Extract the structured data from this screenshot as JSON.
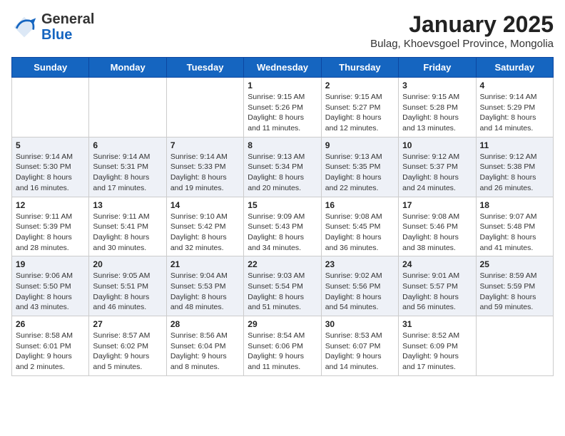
{
  "logo": {
    "general": "General",
    "blue": "Blue"
  },
  "title": "January 2025",
  "subtitle": "Bulag, Khoevsgoel Province, Mongolia",
  "weekdays": [
    "Sunday",
    "Monday",
    "Tuesday",
    "Wednesday",
    "Thursday",
    "Friday",
    "Saturday"
  ],
  "weeks": [
    [
      {
        "day": "",
        "sunrise": "",
        "sunset": "",
        "daylight": ""
      },
      {
        "day": "",
        "sunrise": "",
        "sunset": "",
        "daylight": ""
      },
      {
        "day": "",
        "sunrise": "",
        "sunset": "",
        "daylight": ""
      },
      {
        "day": "1",
        "sunrise": "Sunrise: 9:15 AM",
        "sunset": "Sunset: 5:26 PM",
        "daylight": "Daylight: 8 hours and 11 minutes."
      },
      {
        "day": "2",
        "sunrise": "Sunrise: 9:15 AM",
        "sunset": "Sunset: 5:27 PM",
        "daylight": "Daylight: 8 hours and 12 minutes."
      },
      {
        "day": "3",
        "sunrise": "Sunrise: 9:15 AM",
        "sunset": "Sunset: 5:28 PM",
        "daylight": "Daylight: 8 hours and 13 minutes."
      },
      {
        "day": "4",
        "sunrise": "Sunrise: 9:14 AM",
        "sunset": "Sunset: 5:29 PM",
        "daylight": "Daylight: 8 hours and 14 minutes."
      }
    ],
    [
      {
        "day": "5",
        "sunrise": "Sunrise: 9:14 AM",
        "sunset": "Sunset: 5:30 PM",
        "daylight": "Daylight: 8 hours and 16 minutes."
      },
      {
        "day": "6",
        "sunrise": "Sunrise: 9:14 AM",
        "sunset": "Sunset: 5:31 PM",
        "daylight": "Daylight: 8 hours and 17 minutes."
      },
      {
        "day": "7",
        "sunrise": "Sunrise: 9:14 AM",
        "sunset": "Sunset: 5:33 PM",
        "daylight": "Daylight: 8 hours and 19 minutes."
      },
      {
        "day": "8",
        "sunrise": "Sunrise: 9:13 AM",
        "sunset": "Sunset: 5:34 PM",
        "daylight": "Daylight: 8 hours and 20 minutes."
      },
      {
        "day": "9",
        "sunrise": "Sunrise: 9:13 AM",
        "sunset": "Sunset: 5:35 PM",
        "daylight": "Daylight: 8 hours and 22 minutes."
      },
      {
        "day": "10",
        "sunrise": "Sunrise: 9:12 AM",
        "sunset": "Sunset: 5:37 PM",
        "daylight": "Daylight: 8 hours and 24 minutes."
      },
      {
        "day": "11",
        "sunrise": "Sunrise: 9:12 AM",
        "sunset": "Sunset: 5:38 PM",
        "daylight": "Daylight: 8 hours and 26 minutes."
      }
    ],
    [
      {
        "day": "12",
        "sunrise": "Sunrise: 9:11 AM",
        "sunset": "Sunset: 5:39 PM",
        "daylight": "Daylight: 8 hours and 28 minutes."
      },
      {
        "day": "13",
        "sunrise": "Sunrise: 9:11 AM",
        "sunset": "Sunset: 5:41 PM",
        "daylight": "Daylight: 8 hours and 30 minutes."
      },
      {
        "day": "14",
        "sunrise": "Sunrise: 9:10 AM",
        "sunset": "Sunset: 5:42 PM",
        "daylight": "Daylight: 8 hours and 32 minutes."
      },
      {
        "day": "15",
        "sunrise": "Sunrise: 9:09 AM",
        "sunset": "Sunset: 5:43 PM",
        "daylight": "Daylight: 8 hours and 34 minutes."
      },
      {
        "day": "16",
        "sunrise": "Sunrise: 9:08 AM",
        "sunset": "Sunset: 5:45 PM",
        "daylight": "Daylight: 8 hours and 36 minutes."
      },
      {
        "day": "17",
        "sunrise": "Sunrise: 9:08 AM",
        "sunset": "Sunset: 5:46 PM",
        "daylight": "Daylight: 8 hours and 38 minutes."
      },
      {
        "day": "18",
        "sunrise": "Sunrise: 9:07 AM",
        "sunset": "Sunset: 5:48 PM",
        "daylight": "Daylight: 8 hours and 41 minutes."
      }
    ],
    [
      {
        "day": "19",
        "sunrise": "Sunrise: 9:06 AM",
        "sunset": "Sunset: 5:50 PM",
        "daylight": "Daylight: 8 hours and 43 minutes."
      },
      {
        "day": "20",
        "sunrise": "Sunrise: 9:05 AM",
        "sunset": "Sunset: 5:51 PM",
        "daylight": "Daylight: 8 hours and 46 minutes."
      },
      {
        "day": "21",
        "sunrise": "Sunrise: 9:04 AM",
        "sunset": "Sunset: 5:53 PM",
        "daylight": "Daylight: 8 hours and 48 minutes."
      },
      {
        "day": "22",
        "sunrise": "Sunrise: 9:03 AM",
        "sunset": "Sunset: 5:54 PM",
        "daylight": "Daylight: 8 hours and 51 minutes."
      },
      {
        "day": "23",
        "sunrise": "Sunrise: 9:02 AM",
        "sunset": "Sunset: 5:56 PM",
        "daylight": "Daylight: 8 hours and 54 minutes."
      },
      {
        "day": "24",
        "sunrise": "Sunrise: 9:01 AM",
        "sunset": "Sunset: 5:57 PM",
        "daylight": "Daylight: 8 hours and 56 minutes."
      },
      {
        "day": "25",
        "sunrise": "Sunrise: 8:59 AM",
        "sunset": "Sunset: 5:59 PM",
        "daylight": "Daylight: 8 hours and 59 minutes."
      }
    ],
    [
      {
        "day": "26",
        "sunrise": "Sunrise: 8:58 AM",
        "sunset": "Sunset: 6:01 PM",
        "daylight": "Daylight: 9 hours and 2 minutes."
      },
      {
        "day": "27",
        "sunrise": "Sunrise: 8:57 AM",
        "sunset": "Sunset: 6:02 PM",
        "daylight": "Daylight: 9 hours and 5 minutes."
      },
      {
        "day": "28",
        "sunrise": "Sunrise: 8:56 AM",
        "sunset": "Sunset: 6:04 PM",
        "daylight": "Daylight: 9 hours and 8 minutes."
      },
      {
        "day": "29",
        "sunrise": "Sunrise: 8:54 AM",
        "sunset": "Sunset: 6:06 PM",
        "daylight": "Daylight: 9 hours and 11 minutes."
      },
      {
        "day": "30",
        "sunrise": "Sunrise: 8:53 AM",
        "sunset": "Sunset: 6:07 PM",
        "daylight": "Daylight: 9 hours and 14 minutes."
      },
      {
        "day": "31",
        "sunrise": "Sunrise: 8:52 AM",
        "sunset": "Sunset: 6:09 PM",
        "daylight": "Daylight: 9 hours and 17 minutes."
      },
      {
        "day": "",
        "sunrise": "",
        "sunset": "",
        "daylight": ""
      }
    ]
  ]
}
